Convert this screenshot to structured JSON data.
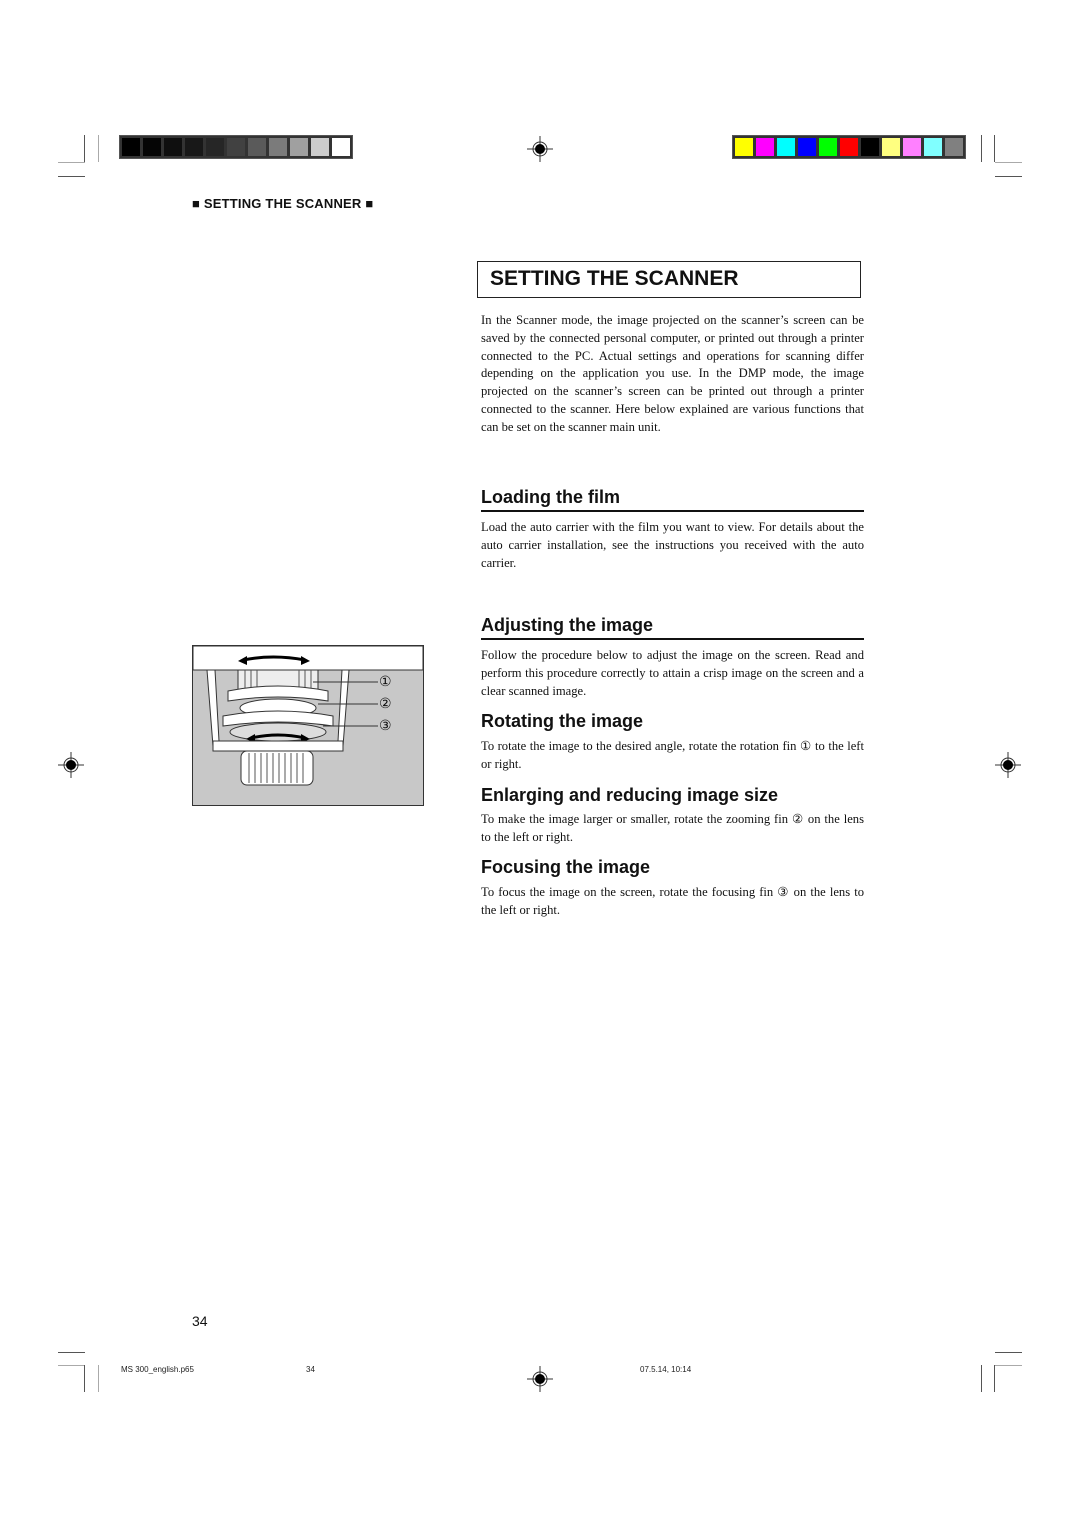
{
  "print_marks": {
    "grayscale_bar": [
      "#000000",
      "#050505",
      "#0f0f0f",
      "#181818",
      "#262626",
      "#414141",
      "#5a5a5a",
      "#7b7b7b",
      "#a0a0a0",
      "#cccccc",
      "#ffffff"
    ],
    "color_bar": [
      "#ffff00",
      "#ff00ff",
      "#00ffff",
      "#0000ff",
      "#00ff00",
      "#ff0000",
      "#000000",
      "#ffff80",
      "#ff80ff",
      "#80ffff",
      "#808080"
    ]
  },
  "running_head": {
    "prefix_icon": "■",
    "label": "SETTING THE SCANNER",
    "suffix_icon": "■"
  },
  "page_title": "SETTING THE SCANNER",
  "intro": "In the Scanner mode, the image projected on the scanner’s screen can be saved by the connected personal computer, or printed out through a printer connected to the PC. Actual settings and operations for scanning differ depending on the application you use. In the DMP mode, the image projected on the scanner’s screen can be printed out through a printer connected to the scanner. Here below explained are various functions that can be set on the scanner main unit.",
  "sections": {
    "loading": {
      "heading": "Loading the film",
      "text": "Load the auto carrier with the film you want to view. For details about the auto carrier installation, see the instructions you received with the auto carrier."
    },
    "adjusting": {
      "heading": "Adjusting the image",
      "text": "Follow the procedure below to adjust the image on the screen. Read and perform this procedure correctly to attain a crisp image on the screen and a clear scanned image."
    },
    "rotating": {
      "heading": "Rotating the image",
      "text": "To rotate the image to the desired angle, rotate the rotation fin ① to the left or right."
    },
    "enlarging": {
      "heading": "Enlarging and reducing image size",
      "text": "To make the image larger or smaller, rotate the zooming fin ② on the lens to the left or right."
    },
    "focusing": {
      "heading": "Focusing the image",
      "text": "To focus the image on the screen, rotate the focusing fin ③ on the lens to the left or right."
    }
  },
  "figure": {
    "callouts": [
      "①",
      "②",
      "③"
    ]
  },
  "page_number": "34",
  "footer": {
    "file": "MS 300_english.p65",
    "page": "34",
    "timestamp": "07.5.14, 10:14"
  }
}
